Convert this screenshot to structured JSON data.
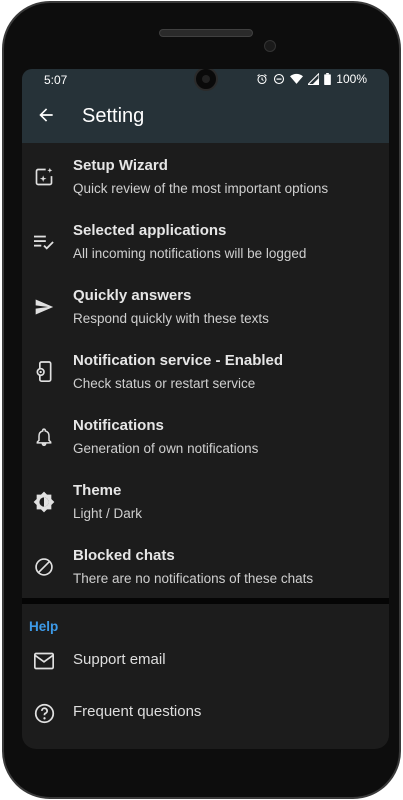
{
  "status_bar": {
    "time": "5:07",
    "battery": "100%",
    "icons": [
      "alarm-icon",
      "dnd-icon",
      "wifi-icon",
      "signal-icon",
      "battery-icon"
    ]
  },
  "app_bar": {
    "title": "Setting",
    "back_icon": "arrow-back-icon"
  },
  "settings": [
    {
      "title": "Setup Wizard",
      "subtitle": "Quick review of the most important options",
      "icon": "wizard-icon"
    },
    {
      "title": "Selected applications",
      "subtitle": "All incoming notifications will be logged",
      "icon": "checklist-icon"
    },
    {
      "title": "Quickly answers",
      "subtitle": "Respond quickly with these texts",
      "icon": "send-icon"
    },
    {
      "title": "Notification service - Enabled",
      "subtitle": "Check status or restart service",
      "icon": "phone-settings-icon"
    },
    {
      "title": "Notifications",
      "subtitle": "Generation of own notifications",
      "icon": "bell-icon"
    },
    {
      "title": "Theme",
      "subtitle": "Light / Dark",
      "icon": "theme-icon"
    },
    {
      "title": "Blocked chats",
      "subtitle": "There are no notifications of these chats",
      "icon": "block-icon"
    }
  ],
  "help": {
    "header": "Help",
    "items": [
      {
        "label": "Support email",
        "icon": "mail-icon"
      },
      {
        "label": "Frequent questions",
        "icon": "help-circle-icon"
      }
    ]
  },
  "colors": {
    "app_bar": "#263238",
    "background": "#1c1c1c",
    "accent": "#3d9ae8"
  }
}
